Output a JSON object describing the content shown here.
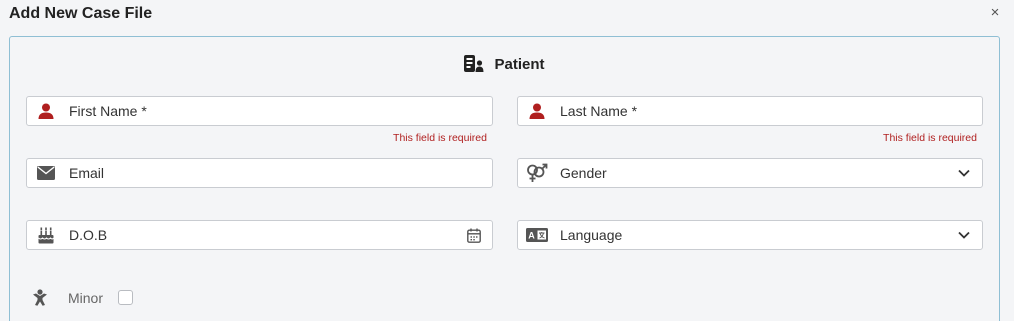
{
  "dialog": {
    "title": "Add New Case File",
    "close_symbol": "×"
  },
  "section": {
    "title": "Patient",
    "icon": "patient-card-icon"
  },
  "fields": {
    "first_name": {
      "placeholder": "First Name *",
      "icon": "user-icon",
      "error": "This field is required"
    },
    "last_name": {
      "placeholder": "Last Name *",
      "icon": "user-icon",
      "error": "This field is required"
    },
    "email": {
      "placeholder": "Email",
      "icon": "envelope-icon"
    },
    "gender": {
      "label": "Gender",
      "icon": "gender-icon"
    },
    "dob": {
      "placeholder": "D.O.B",
      "icon": "birthday-cake-icon"
    },
    "language": {
      "label": "Language",
      "icon": "language-icon"
    },
    "minor": {
      "label": "Minor",
      "icon": "child-icon",
      "checked": false
    }
  },
  "colors": {
    "required_icon": "#b01f1f",
    "neutral_icon": "#555555",
    "error_text": "#b01f1f",
    "panel_border": "#8fbfd4"
  }
}
